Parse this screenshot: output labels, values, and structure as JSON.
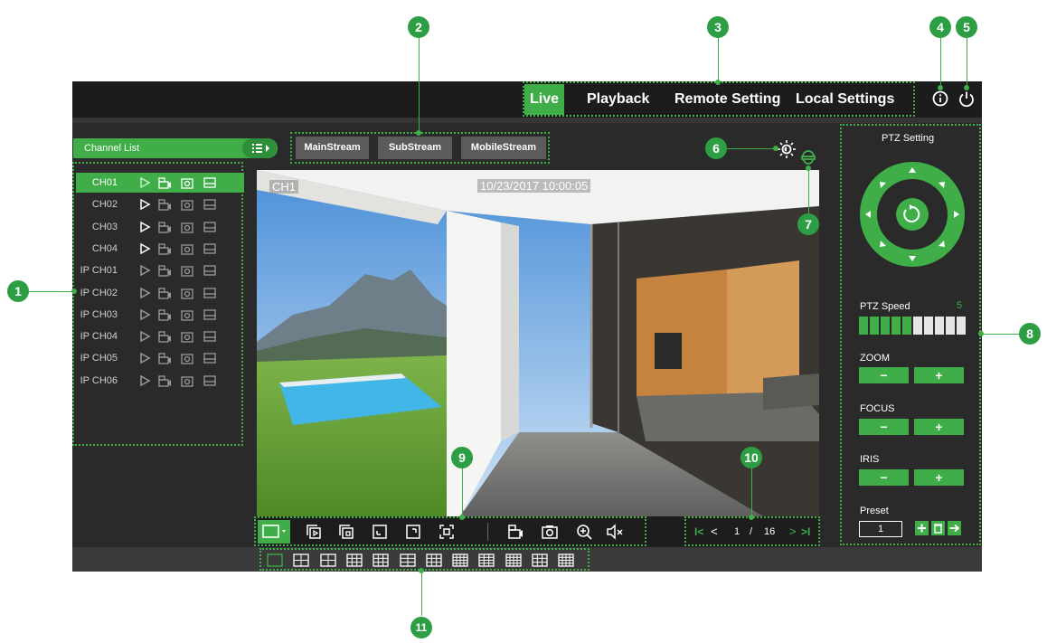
{
  "colors": {
    "accent": "#3fae49",
    "callout": "#2e9e44",
    "frame": "#2a2a2a",
    "topbar": "#1c1c1c"
  },
  "nav": {
    "tabs": [
      {
        "label": "Live",
        "active": true
      },
      {
        "label": "Playback",
        "active": false
      },
      {
        "label": "Remote Setting",
        "active": false
      },
      {
        "label": "Local Settings",
        "active": false
      }
    ],
    "icons": [
      "info-icon",
      "power-icon"
    ]
  },
  "channel_list": {
    "title": "Channel List",
    "channels": [
      {
        "name": "CH01",
        "active": true
      },
      {
        "name": "CH02",
        "active": false
      },
      {
        "name": "CH03",
        "active": false
      },
      {
        "name": "CH04",
        "active": false
      },
      {
        "name": "IP CH01",
        "active": false
      },
      {
        "name": "IP CH02",
        "active": false
      },
      {
        "name": "IP CH03",
        "active": false
      },
      {
        "name": "IP CH04",
        "active": false
      },
      {
        "name": "IP CH05",
        "active": false
      },
      {
        "name": "IP CH06",
        "active": false
      }
    ]
  },
  "streams": [
    "MainStream",
    "SubStream",
    "MobileStream"
  ],
  "video": {
    "channel_label": "CH1",
    "timestamp": "10/23/2017 10:00:05"
  },
  "ptz": {
    "title": "PTZ Setting",
    "speed_label": "PTZ Speed",
    "speed_value": "5",
    "speed_level": 5,
    "speed_max": 10,
    "zoom_label": "ZOOM",
    "focus_label": "FOCUS",
    "iris_label": "IRIS",
    "minus": "−",
    "plus": "+",
    "preset_label": "Preset",
    "preset_value": "1"
  },
  "pager": {
    "current": "1",
    "separator": "/",
    "total": "16"
  },
  "callouts": [
    "1",
    "2",
    "3",
    "4",
    "5",
    "6",
    "7",
    "8",
    "9",
    "10",
    "11"
  ]
}
